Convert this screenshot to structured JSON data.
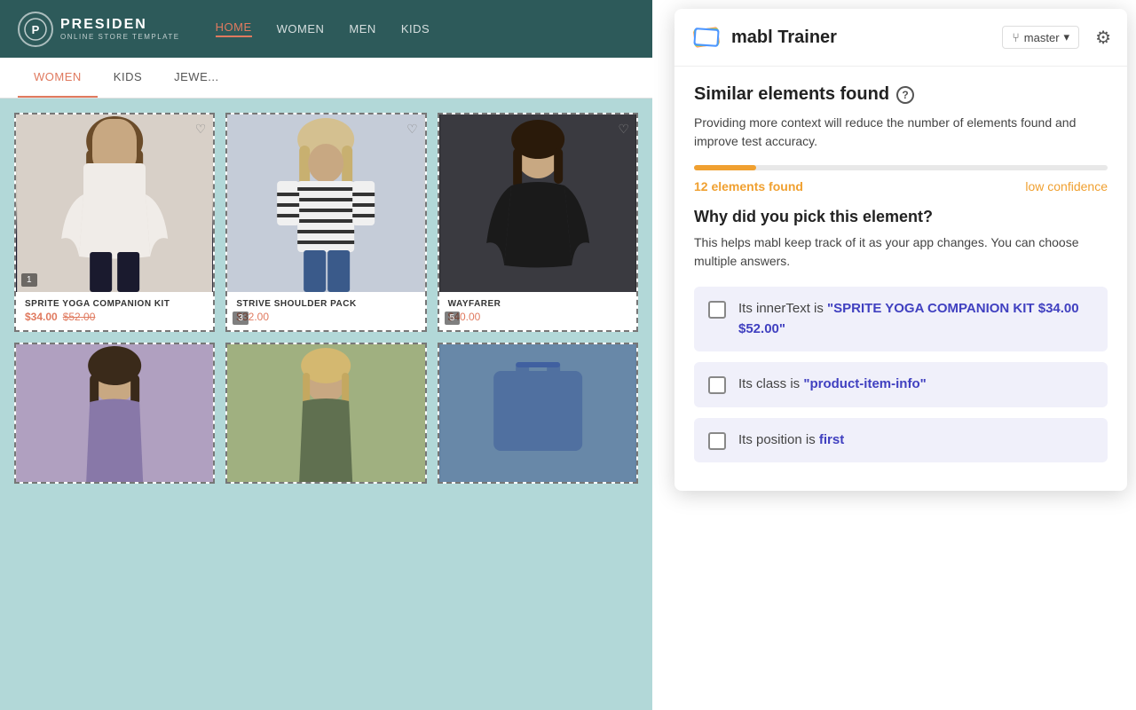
{
  "store": {
    "logo": {
      "icon": "P",
      "name": "PRESIDEN",
      "subtitle": "ONLINE STORE TEMPLATE"
    },
    "nav": {
      "items": [
        {
          "label": "HOME",
          "active": true
        },
        {
          "label": "WOMEN",
          "active": false
        },
        {
          "label": "MEN",
          "active": false
        },
        {
          "label": "KIDS",
          "active": false
        }
      ]
    },
    "categories": [
      {
        "label": "WOMEN",
        "active": true
      },
      {
        "label": "KIDS",
        "active": false
      },
      {
        "label": "JEWE...",
        "active": false
      }
    ],
    "products": [
      {
        "name": "SPRITE YOGA COMPANION KIT",
        "price_sale": "$34.00",
        "price_original": "$52.00",
        "badge": "1",
        "selected": true
      },
      {
        "name": "STRIVE SHOULDER PACK",
        "price_sale": "$32.00",
        "price_original": null,
        "badge": "3",
        "selected": true
      },
      {
        "name": "WAYFARER",
        "price_sale": "$40.00",
        "price_original": null,
        "badge": "5",
        "selected": true
      },
      {
        "name": "",
        "price_sale": "",
        "price_original": null,
        "badge": null,
        "selected": true
      },
      {
        "name": "",
        "price_sale": "",
        "price_original": null,
        "badge": null,
        "selected": true
      },
      {
        "name": "",
        "price_sale": "",
        "price_original": null,
        "badge": null,
        "selected": true
      }
    ]
  },
  "mabl": {
    "logo_alt": "mabl logo",
    "title": "mabl Trainer",
    "branch_label": "master",
    "branch_icon": "⑂",
    "chevron": "▾",
    "gear_icon": "⚙",
    "panel": {
      "similar_title": "Similar elements found",
      "help_icon": "?",
      "description": "Providing more context will reduce the number of elements found and improve test accuracy.",
      "progress_percent": 15,
      "elements_found": "12 elements found",
      "confidence": "low confidence",
      "why_title": "Why did you pick this element?",
      "why_desc": "This helps mabl keep track of it as your app changes. You can choose multiple answers.",
      "options": [
        {
          "id": "option-innertext",
          "text_before": "Its innerText is ",
          "text_value": "\"SPRITE YOGA COMPANION KIT $34.00 $52.00\"",
          "checked": false
        },
        {
          "id": "option-class",
          "text_before": "Its class is ",
          "text_value": "\"product-item-info\"",
          "checked": false
        },
        {
          "id": "option-position",
          "text_before": "Its position is ",
          "text_value": "first",
          "checked": false
        }
      ]
    }
  }
}
